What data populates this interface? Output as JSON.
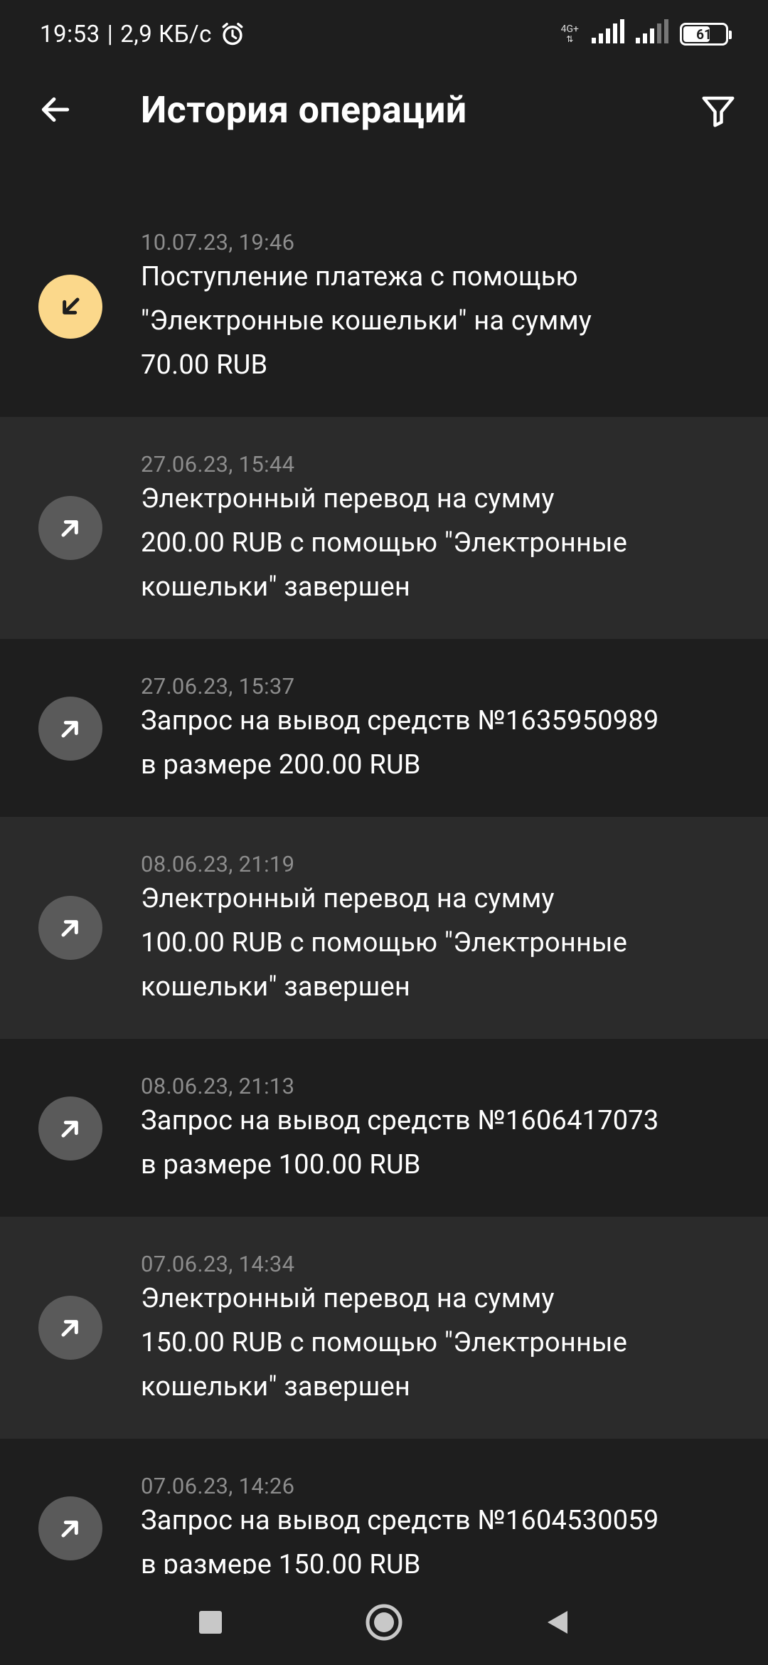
{
  "status_bar": {
    "time": "19:53",
    "separator": "|",
    "net_speed": "2,9 КБ/с",
    "network_type": "4G+",
    "battery": "61"
  },
  "header": {
    "title": "История операций"
  },
  "operations": [
    {
      "date": "10.07.23, 19:46",
      "line1": "Поступление платежа с помощью",
      "line2": "\"Электронные кошельки\" на сумму",
      "line3": "70.00 RUB",
      "type": "incoming"
    },
    {
      "date": "27.06.23, 15:44",
      "line1": "Электронный перевод на сумму",
      "line2": "200.00 RUB с помощью \"Электронные",
      "line3": "кошельки\" завершен",
      "type": "outgoing"
    },
    {
      "date": "27.06.23, 15:37",
      "line1": "Запрос на вывод средств №1635950989",
      "line2": "в размере 200.00 RUB",
      "line3": "",
      "type": "outgoing"
    },
    {
      "date": "08.06.23, 21:19",
      "line1": "Электронный перевод на сумму",
      "line2": "100.00 RUB с помощью \"Электронные",
      "line3": "кошельки\" завершен",
      "type": "outgoing"
    },
    {
      "date": "08.06.23, 21:13",
      "line1": "Запрос на вывод средств №1606417073",
      "line2": "в размере 100.00 RUB",
      "line3": "",
      "type": "outgoing"
    },
    {
      "date": "07.06.23, 14:34",
      "line1": "Электронный перевод на сумму",
      "line2": "150.00 RUB с помощью \"Электронные",
      "line3": "кошельки\" завершен",
      "type": "outgoing"
    },
    {
      "date": "07.06.23, 14:26",
      "line1": "Запрос на вывод средств №1604530059",
      "line2": "в размере 150.00 RUB",
      "line3": "",
      "type": "outgoing"
    }
  ],
  "nav_bar": {
    "icons": [
      "recents-icon",
      "home-icon",
      "back-icon"
    ]
  },
  "colors": {
    "background": "#1e1e1e",
    "row_alt": "#2b2b2b",
    "incoming_icon": "#fbd88b",
    "outgoing_icon": "#5a5a5a",
    "date_text": "#8d8d8d"
  }
}
